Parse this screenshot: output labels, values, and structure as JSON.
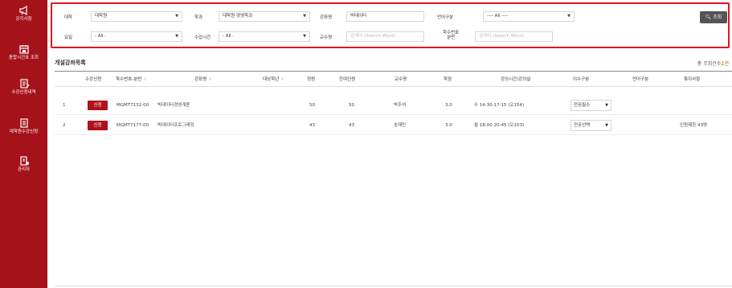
{
  "sidebar": {
    "items": [
      {
        "label": "공지사항",
        "icon": "megaphone-icon"
      },
      {
        "label": "종합시간표 조회",
        "icon": "calendar-icon"
      },
      {
        "label": "수강신청내역",
        "icon": "list-icon"
      },
      {
        "label": "대학원수강신청",
        "icon": "document-icon"
      },
      {
        "label": "관리자",
        "icon": "admin-icon"
      }
    ]
  },
  "filter": {
    "university_label": "대학",
    "university_value": "대학원",
    "department_label": "학과",
    "department_value": "대학원 경영학과",
    "course_name_label": "강좌명",
    "course_name_value": "빅데이터",
    "language_label": "언어구분",
    "language_value": "---- All ----",
    "day_label": "요일",
    "day_value": "- All -",
    "class_time_label": "수업시간",
    "class_time_value": "- All -",
    "professor_label": "교수명",
    "professor_placeholder": "검색어 (Search Word)",
    "course_code_label_1": "학수번호",
    "course_code_label_2": "분반",
    "course_code_placeholder": "검색어 (Search Word)",
    "search_button": "조회"
  },
  "list": {
    "title": "개설강좌목록",
    "total_prefix": "총 조회건수",
    "total_count": "2",
    "total_suffix": "건"
  },
  "table": {
    "headers": [
      "수강신청",
      "학수번호-분반",
      "강좌명",
      "대상학년",
      "정원",
      "잔여인원",
      "교수명",
      "학점",
      "강의시간/강의실",
      "이수구분",
      "언어구분",
      "특이사항"
    ],
    "rows": [
      {
        "no": "1",
        "apply": "신청",
        "code": "MGMT7132-00",
        "name": "빅데이터경영개론",
        "grade": "",
        "capacity": "50",
        "remaining": "50",
        "professor": "박주석",
        "credit": "3.0",
        "time": "수 14:30-17:15 (오154)",
        "category": "전공필수",
        "language": "",
        "note": ""
      },
      {
        "no": "2",
        "apply": "신청",
        "code": "MGMT7177-00",
        "name": "빅데이터프로그래밍",
        "grade": "",
        "capacity": "43",
        "remaining": "43",
        "professor": "송재민",
        "credit": "3.0",
        "time": "월 18:00-20:45 (오103)",
        "category": "전공선택",
        "language": "",
        "note": "인원제한 43명"
      }
    ]
  },
  "colors": {
    "sidebar": "#a5121a",
    "accent": "#b0121a",
    "filter_border": "#e0141e",
    "count": "#e3a000"
  }
}
